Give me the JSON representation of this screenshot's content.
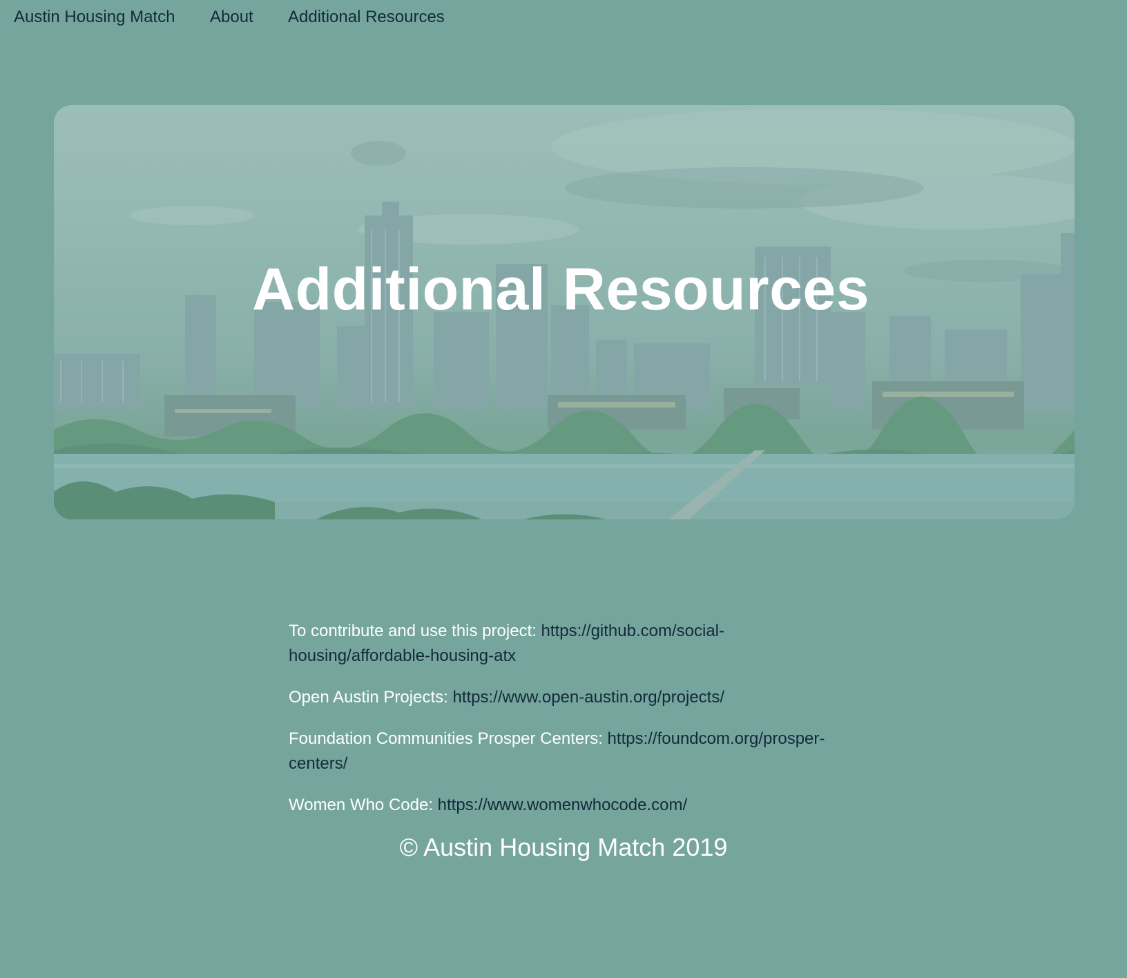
{
  "nav": {
    "brand": "Austin Housing Match",
    "about": "About",
    "resources": "Additional Resources"
  },
  "hero": {
    "title": "Additional Resources",
    "image_description_icon": "city-skyline-image"
  },
  "resources": [
    {
      "label": "To contribute and use this project: ",
      "url": "https://github.com/social-housing/affordable-housing-atx"
    },
    {
      "label": "Open Austin Projects: ",
      "url": "https://www.open-austin.org/projects/"
    },
    {
      "label": "Foundation Communities Prosper Centers: ",
      "url": "https://foundcom.org/prosper-centers/"
    },
    {
      "label": "Women Who Code: ",
      "url": "https://www.womenwhocode.com/"
    }
  ],
  "footer": {
    "copyright": "© Austin Housing Match 2019"
  },
  "colors": {
    "background": "#75a59d",
    "nav_text": "#142a3a",
    "link_text": "#142a3a",
    "body_text": "#ffffff"
  }
}
